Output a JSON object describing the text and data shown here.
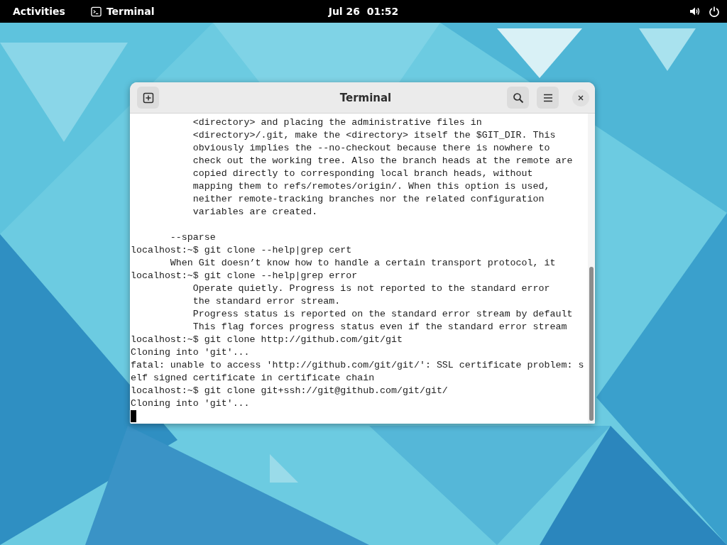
{
  "top_bar": {
    "activities": "Activities",
    "app": "Terminal",
    "clock": "Jul 26  01:52"
  },
  "window": {
    "title": "Terminal",
    "lines": [
      {
        "text": "           <directory> and placing the administrative files in"
      },
      {
        "text": "           <directory>/.git, make the <directory> itself the $GIT_DIR. This"
      },
      {
        "text": "           obviously implies the --no-checkout because there is nowhere to"
      },
      {
        "text": "           check out the working tree. Also the branch heads at the remote are"
      },
      {
        "text": "           copied directly to corresponding local branch heads, without"
      },
      {
        "text": "           mapping them to refs/remotes/origin/. When this option is used,"
      },
      {
        "text": "           neither remote-tracking branches nor the related configuration"
      },
      {
        "text": "           variables are created."
      },
      {
        "text": "       --sparse",
        "space_before": true
      },
      {
        "text": "localhost:~$ git clone --help|grep cert"
      },
      {
        "text": "       When Git doesn’t know how to handle a certain transport protocol, it"
      },
      {
        "text": "localhost:~$ git clone --help|grep error"
      },
      {
        "text": "           Operate quietly. Progress is not reported to the standard error"
      },
      {
        "text": "           the standard error stream."
      },
      {
        "text": "           Progress status is reported on the standard error stream by default"
      },
      {
        "text": "           This flag forces progress status even if the standard error stream"
      },
      {
        "text": "localhost:~$ git clone http://github.com/git/git"
      },
      {
        "text": "Cloning into 'git'..."
      },
      {
        "text": "fatal: unable to access 'http://github.com/git/git/': SSL certificate problem: s"
      },
      {
        "text": "elf signed certificate in certificate chain"
      },
      {
        "text": "localhost:~$ git clone git+ssh://git@github.com/git/git/"
      },
      {
        "text": "Cloning into 'git'..."
      }
    ]
  }
}
